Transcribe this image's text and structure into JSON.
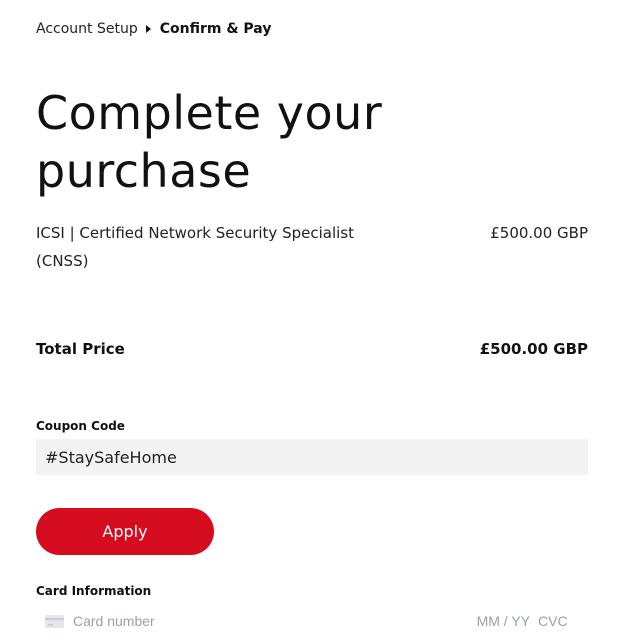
{
  "breadcrumb": {
    "step1": "Account Setup",
    "step2": "Confirm & Pay"
  },
  "title": "Complete your purchase",
  "order": {
    "item_name": "ICSI | Certified Network Security Specialist (CNSS)",
    "item_price": "£500.00 GBP",
    "total_label": "Total Price",
    "total_value": "£500.00 GBP"
  },
  "coupon": {
    "label": "Coupon Code",
    "value": "#StaySafeHome",
    "apply_label": "Apply"
  },
  "card": {
    "label": "Card Information",
    "number_placeholder": "Card number",
    "expiry_placeholder": "MM / YY",
    "cvc_placeholder": "CVC",
    "icon": "credit-card-icon"
  },
  "colors": {
    "accent": "#d50b1f",
    "input_bg": "#f3f3f3",
    "placeholder": "#9aa1ab"
  }
}
